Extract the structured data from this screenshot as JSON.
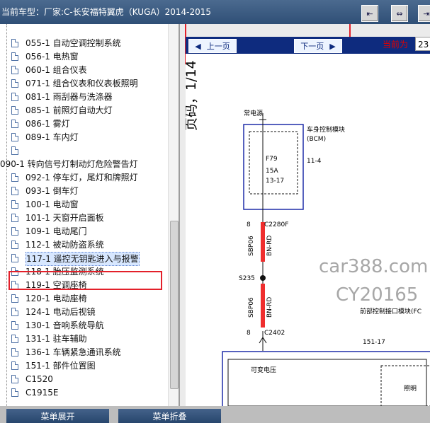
{
  "window": {
    "title": "当前车型：厂家:C-长安福特翼虎（KUGA）2014-2015",
    "buttons": [
      "⇤",
      "⇔",
      "⇥"
    ]
  },
  "sidebar": {
    "items": [
      {
        "label": "055-1 自动空调控制系统"
      },
      {
        "label": "056-1 电热窗"
      },
      {
        "label": "060-1 组合仪表"
      },
      {
        "label": "071-1 组合仪表和仪表板照明"
      },
      {
        "label": "081-1 雨刮器与洗涤器"
      },
      {
        "label": "085-1 前照灯自动大灯"
      },
      {
        "label": "086-1 雾灯"
      },
      {
        "label": "089-1 车内灯"
      },
      {
        "label": ""
      },
      {
        "label": "090-1 转向信号灯制动灯危险警告灯"
      },
      {
        "label": "092-1 停车灯，尾灯和牌照灯"
      },
      {
        "label": "093-1 倒车灯"
      },
      {
        "label": "100-1 电动窗"
      },
      {
        "label": "101-1 天窗开启面板"
      },
      {
        "label": "109-1 电动尾门"
      },
      {
        "label": "112-1 被动防盗系统"
      },
      {
        "label": "117-1 遥控无钥匙进入与报警"
      },
      {
        "label": "118-1 胎压监测系统"
      },
      {
        "label": "119-1 空调座椅"
      },
      {
        "label": "120-1 电动座椅"
      },
      {
        "label": "124-1 电动后视镜"
      },
      {
        "label": "130-1 音响系统导航"
      },
      {
        "label": "131-1 驻车辅助"
      },
      {
        "label": "136-1 车辆紧急通讯系统"
      },
      {
        "label": "151-1 部件位置图"
      },
      {
        "label": "C1520"
      },
      {
        "label": "C1915E"
      }
    ]
  },
  "toolbar": {
    "prev_label": "上一页",
    "next_label": "下一页",
    "current_label": "当前为",
    "current_page": "23"
  },
  "diagram": {
    "page_marker": "页码，1/14",
    "power": "常电源",
    "bcm": "车身控制模块",
    "bcm_code": "(BCM)",
    "fuse": "F79",
    "amp": "15A",
    "fuse_loc": "13-17",
    "pin1": "11-4",
    "pin8a": "8",
    "connector1": "C2280F",
    "wire1": "SBP06",
    "color1": "BN-RD",
    "splice": "S235",
    "wire2": "SBP06",
    "color2": "BN-RD",
    "pin8b": "8",
    "connector2": "C2402",
    "interface": "前部控制接口模块(FC",
    "loc2": "151-17",
    "voltage": "可变电压",
    "lighting": "照明"
  },
  "watermark": {
    "line1": "car388.com",
    "line2": "CY20165"
  },
  "bottom": {
    "left": "菜单展开",
    "right": "菜单折叠"
  }
}
